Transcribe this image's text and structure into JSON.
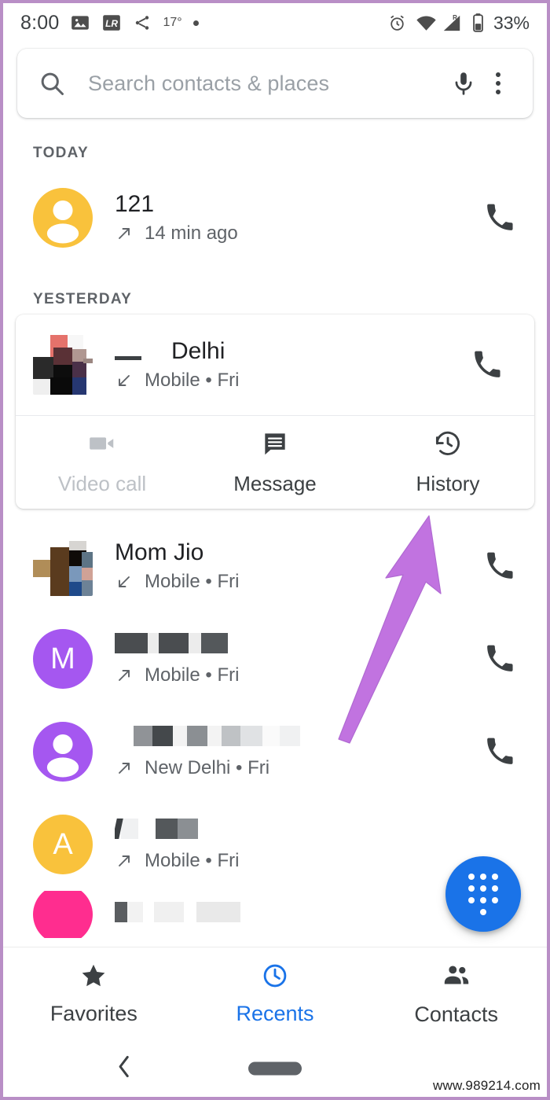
{
  "status_bar": {
    "time": "8:00",
    "temperature": "17°",
    "battery": "33%",
    "icons": [
      "image-icon",
      "lr-app-icon",
      "share-icon",
      "dot-icon",
      "alarm-icon",
      "wifi-icon",
      "signal-roaming-icon",
      "battery-icon"
    ]
  },
  "search": {
    "placeholder": "Search contacts & places",
    "icons": [
      "search-icon",
      "microphone-icon",
      "overflow-menu-icon"
    ]
  },
  "sections": {
    "today": "TODAY",
    "yesterday": "YESTERDAY"
  },
  "calls": {
    "today": [
      {
        "name": "121",
        "subtitle": "14 min ago",
        "direction": "outgoing",
        "avatar_type": "person",
        "avatar_color": "#F9C23C",
        "avatar_letter": ""
      }
    ],
    "expanded": {
      "name": "Delhi",
      "name_redacted": true,
      "subtitle": "Mobile • Fri",
      "direction": "incoming",
      "avatar_type": "photo",
      "actions": [
        {
          "label": "Video call",
          "icon": "video-camera-icon",
          "enabled": false
        },
        {
          "label": "Message",
          "icon": "message-icon",
          "enabled": true
        },
        {
          "label": "History",
          "icon": "history-clock-icon",
          "enabled": true
        }
      ]
    },
    "yesterday": [
      {
        "name": "Mom Jio",
        "subtitle": "Mobile • Fri",
        "direction": "incoming",
        "avatar_type": "photo",
        "avatar_color": "",
        "avatar_letter": ""
      },
      {
        "name": "",
        "name_redacted": true,
        "subtitle": "Mobile • Fri",
        "direction": "outgoing",
        "avatar_type": "letter",
        "avatar_color": "#A557F0",
        "avatar_letter": "M"
      },
      {
        "name": "",
        "name_redacted": true,
        "subtitle": "New Delhi • Fri",
        "direction": "outgoing",
        "avatar_type": "person",
        "avatar_color": "#A557F0",
        "avatar_letter": ""
      },
      {
        "name": "",
        "name_redacted": true,
        "subtitle": "Mobile • Fri",
        "direction": "outgoing",
        "avatar_type": "letter",
        "avatar_color": "#F9C23C",
        "avatar_letter": "A"
      }
    ]
  },
  "fab": {
    "icon": "dialpad-icon",
    "color": "#1a73e8"
  },
  "bottom_nav": {
    "items": [
      {
        "label": "Favorites",
        "icon": "star-icon",
        "active": false
      },
      {
        "label": "Recents",
        "icon": "clock-icon",
        "active": true
      },
      {
        "label": "Contacts",
        "icon": "people-icon",
        "active": false
      }
    ],
    "active_color": "#1a73e8"
  },
  "system_nav": {
    "back": "back-chevron-icon",
    "home": "home-pill-icon"
  },
  "annotation": {
    "type": "arrow",
    "color": "#c173e0",
    "points_to": "History"
  },
  "watermark": "www.989214.com"
}
